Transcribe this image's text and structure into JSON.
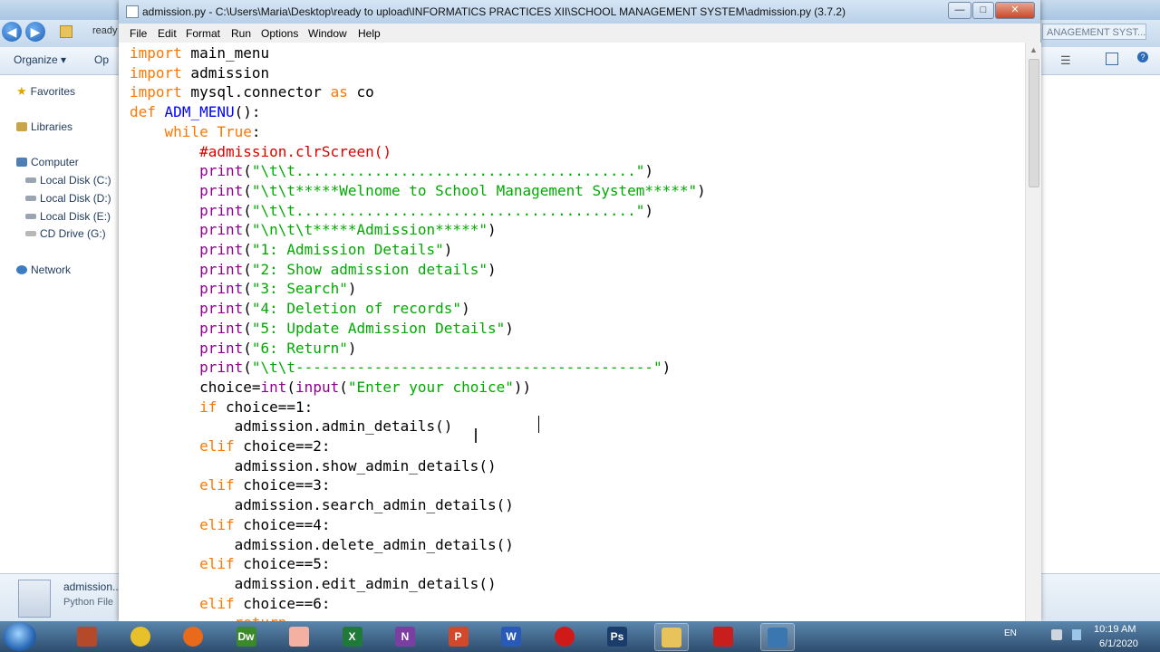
{
  "window_title": "admission.py - C:\\Users\\Maria\\Desktop\\ready to upload\\INFORMATICS PRACTICES XII\\SCHOOL MANAGEMENT SYSTEM\\admission.py (3.7.2)",
  "menu": [
    "File",
    "Edit",
    "Format",
    "Run",
    "Options",
    "Window",
    "Help"
  ],
  "window_buttons": {
    "minimize": "—",
    "maximize": "□",
    "close": "✕"
  },
  "explorer": {
    "toolbar": {
      "organize": "Organize ▾",
      "open": "Op"
    },
    "address_fragment": "ready",
    "search_placeholder": "ANAGEMENT SYST...",
    "nav": {
      "favorites": "Favorites",
      "libraries": "Libraries",
      "computer": "Computer",
      "drives": [
        "Local Disk (C:)",
        "Local Disk (D:)",
        "Local Disk (E:)",
        "CD Drive (G:)"
      ],
      "network": "Network"
    },
    "details": {
      "file_name": "admission...",
      "file_type": "Python File"
    }
  },
  "code_lines": [
    "import main_menu",
    "import admission",
    "import mysql.connector as co",
    "def ADM_MENU():",
    "    while True:",
    "        #admission.clrScreen()",
    "        print(\"\\t\\t.......................................\")",
    "        print(\"\\t\\t*****Welnome to School Management System*****\")",
    "        print(\"\\t\\t.......................................\")",
    "        print(\"\\n\\t\\t*****Admission*****\")",
    "        print(\"1: Admission Details\")",
    "        print(\"2: Show admission details\")",
    "        print(\"3: Search\")",
    "        print(\"4: Deletion of records\")",
    "        print(\"5: Update Admission Details\")",
    "        print(\"6: Return\")",
    "        print(\"\\t\\t-----------------------------------------\")",
    "        choice=int(input(\"Enter your choice\"))",
    "        if choice==1:",
    "            admission.admin_details()",
    "        elif choice==2:",
    "            admission.show_admin_details()",
    "        elif choice==3:",
    "            admission.search_admin_details()",
    "        elif choice==4:",
    "            admission.delete_admin_details()",
    "        elif choice==5:",
    "            admission.edit_admin_details()",
    "        elif choice==6:",
    "            return"
  ],
  "syntax_colors": {
    "keyword": "#ff7700",
    "builtin": "#900090",
    "string": "#00aa00",
    "comment": "#dd0000",
    "definition": "#0000ff"
  },
  "taskbar": {
    "apps": [
      "start",
      "task-manager",
      "chrome",
      "firefox",
      "dreamweaver",
      "paint",
      "excel",
      "onenote",
      "powerpoint",
      "word",
      "opera",
      "photoshop",
      "explorer",
      "acrobat",
      "python"
    ],
    "app_glyphs": {
      "dreamweaver": "Dw",
      "excel": "X",
      "onenote": "N",
      "powerpoint": "P",
      "word": "W",
      "photoshop": "Ps"
    },
    "lang": "EN",
    "time": "10:19 AM",
    "date": "6/1/2020"
  }
}
